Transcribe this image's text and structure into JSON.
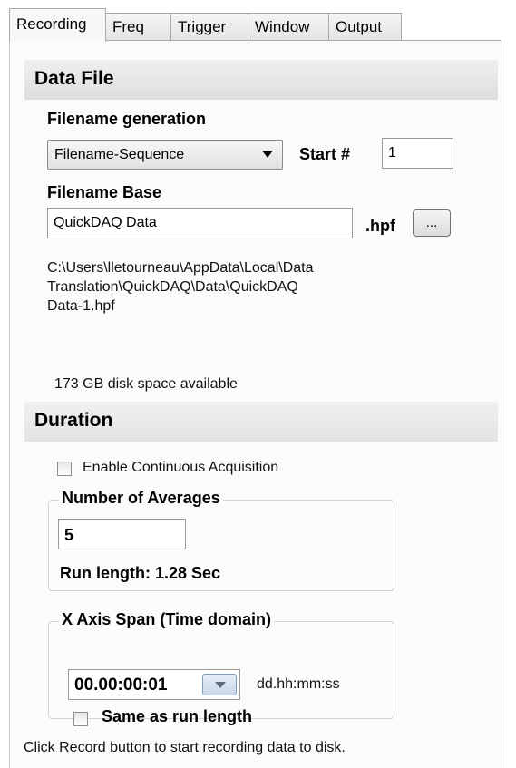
{
  "tabs": [
    "Recording",
    "Freq",
    "Trigger",
    "Window",
    "Output"
  ],
  "data_file": {
    "header": "Data File",
    "filename_generation_label": "Filename generation",
    "filename_generation_value": "Filename-Sequence",
    "start_label": "Start #",
    "start_value": "1",
    "filename_base_label": "Filename Base",
    "filename_base_value": "QuickDAQ Data",
    "extension": ".hpf",
    "browse_label": "...",
    "path_lines": [
      "C:\\Users\\lletourneau\\AppData\\Local\\Data",
      "Translation\\QuickDAQ\\Data\\QuickDAQ",
      "Data-1.hpf"
    ],
    "disk_space": "173 GB disk space available"
  },
  "duration": {
    "header": "Duration",
    "continuous_label": "Enable Continuous Acquisition",
    "continuous_checked": false,
    "averages_group": "Number of Averages",
    "averages_value": "5",
    "run_length": "Run length: 1.28 Sec",
    "span_group": "X Axis Span (Time domain)",
    "span_value": "00.00:00:01",
    "span_format": "dd.hh:mm:ss",
    "same_as_run_label": "Same as run length",
    "same_as_run_checked": false
  },
  "footer_hint": "Click Record button to start recording data to disk."
}
